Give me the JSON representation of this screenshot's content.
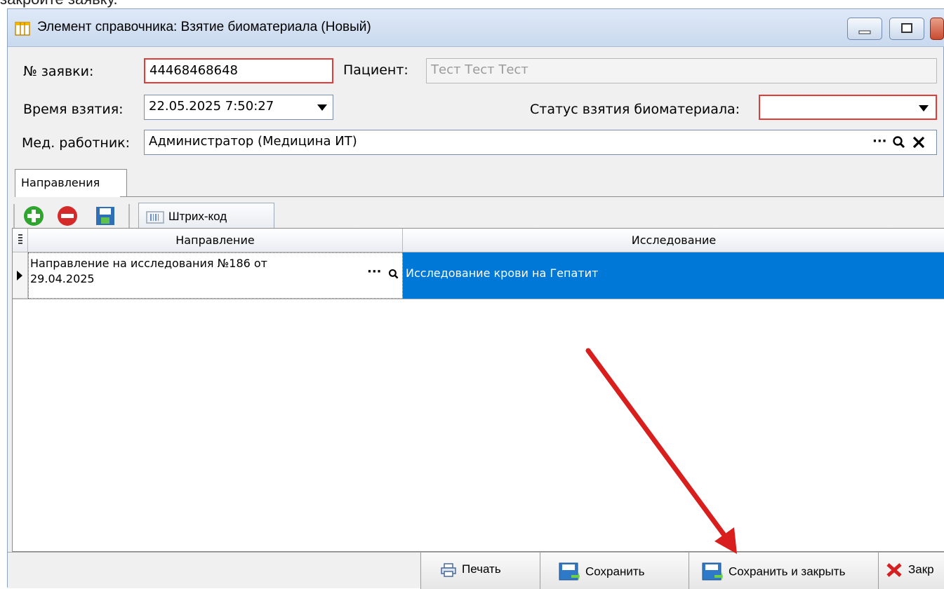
{
  "caption": "закройте заявку.",
  "window": {
    "title": "Элемент справочника: Взятие биоматериала (Новый)"
  },
  "form": {
    "order_label": "№ заявки:",
    "order_value": "44468468648",
    "patient_label": "Пациент:",
    "patient_value": "Тест Тест Тест",
    "time_label": "Время взятия:",
    "time_value": "22.05.2025 7:50:27",
    "status_label": "Статус взятия биоматериала:",
    "status_value": "",
    "worker_label": "Мед. работник:",
    "worker_value": "Администратор (Медицина ИТ)",
    "ellipsis": "···"
  },
  "tabs": [
    {
      "label": "Направления"
    }
  ],
  "toolbar": {
    "barcode_label": "Штрих-код"
  },
  "table": {
    "columns": [
      "Направление",
      "Исследование"
    ],
    "rows": [
      {
        "direction_line1": "Направление на исследования №186 от",
        "direction_line2": "29.04.2025",
        "study": "Исследование крови на Гепатит"
      }
    ],
    "ellipsis": "···"
  },
  "bottom": {
    "print_label": "Печать",
    "save_label": "Сохранить",
    "save_close_label": "Сохранить и закрыть",
    "close_label": "Закр"
  },
  "colors": {
    "selection": "#0078d7",
    "annotation_arrow": "#d91e1e",
    "required_border": "#e33a3a"
  },
  "icons": [
    "table-icon",
    "add-icon",
    "remove-icon",
    "save-icon",
    "barcode-icon",
    "search-icon",
    "clear-icon",
    "print-icon",
    "close-icon",
    "annotation-arrow"
  ]
}
